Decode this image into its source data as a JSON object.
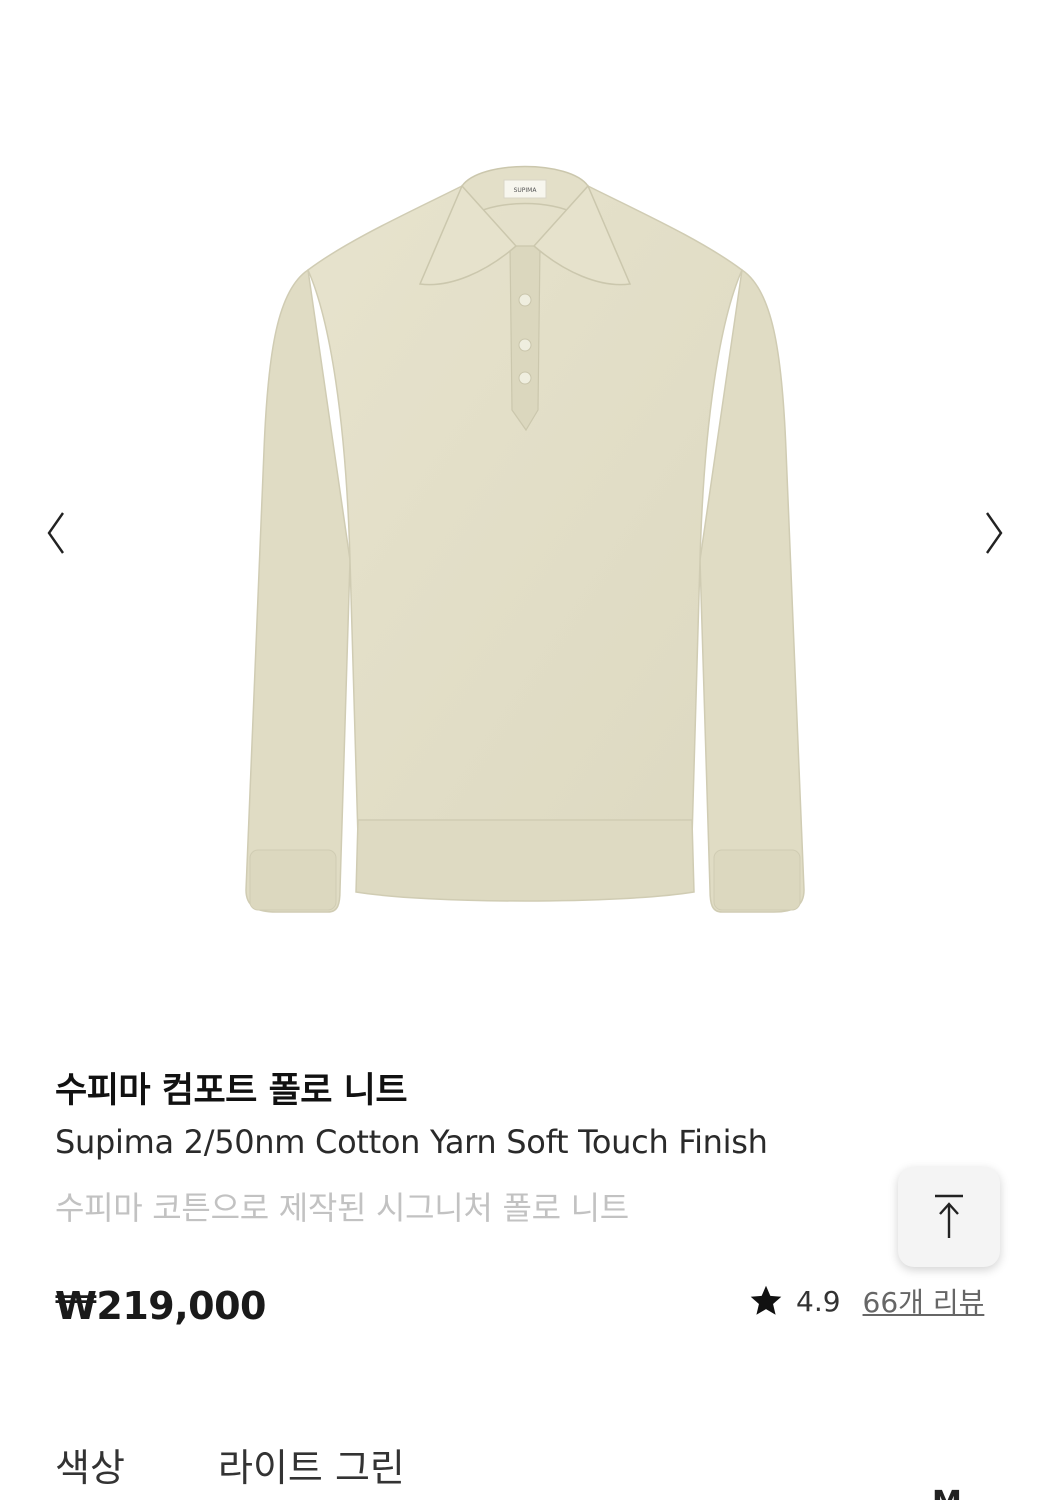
{
  "product": {
    "name": "수피마 컴포트 폴로 니트",
    "subtitle": "Supima 2/50nm Cotton Yarn Soft Touch Finish",
    "description": "수피마 코튼으로 제작된 시그니처 폴로 니트",
    "price": "₩219,000",
    "image_label": "SUPIMA"
  },
  "gallery": {
    "prev_icon": "chevron-left-icon",
    "next_icon": "chevron-right-icon"
  },
  "rating": {
    "score": "4.9",
    "review_count_label": "66개 리뷰",
    "icon": "star-icon"
  },
  "options": {
    "color_label": "색상",
    "color_value": "라이트 그린",
    "next_option_partial": "M"
  },
  "scroll_top": {
    "icon": "arrow-to-top-icon"
  },
  "colors": {
    "knit": "#e4e0c9",
    "knit_shadow": "#d3cfb6",
    "text_primary": "#111111",
    "text_muted": "#c2c2c2",
    "top_button_bg": "#f4f4f4"
  }
}
